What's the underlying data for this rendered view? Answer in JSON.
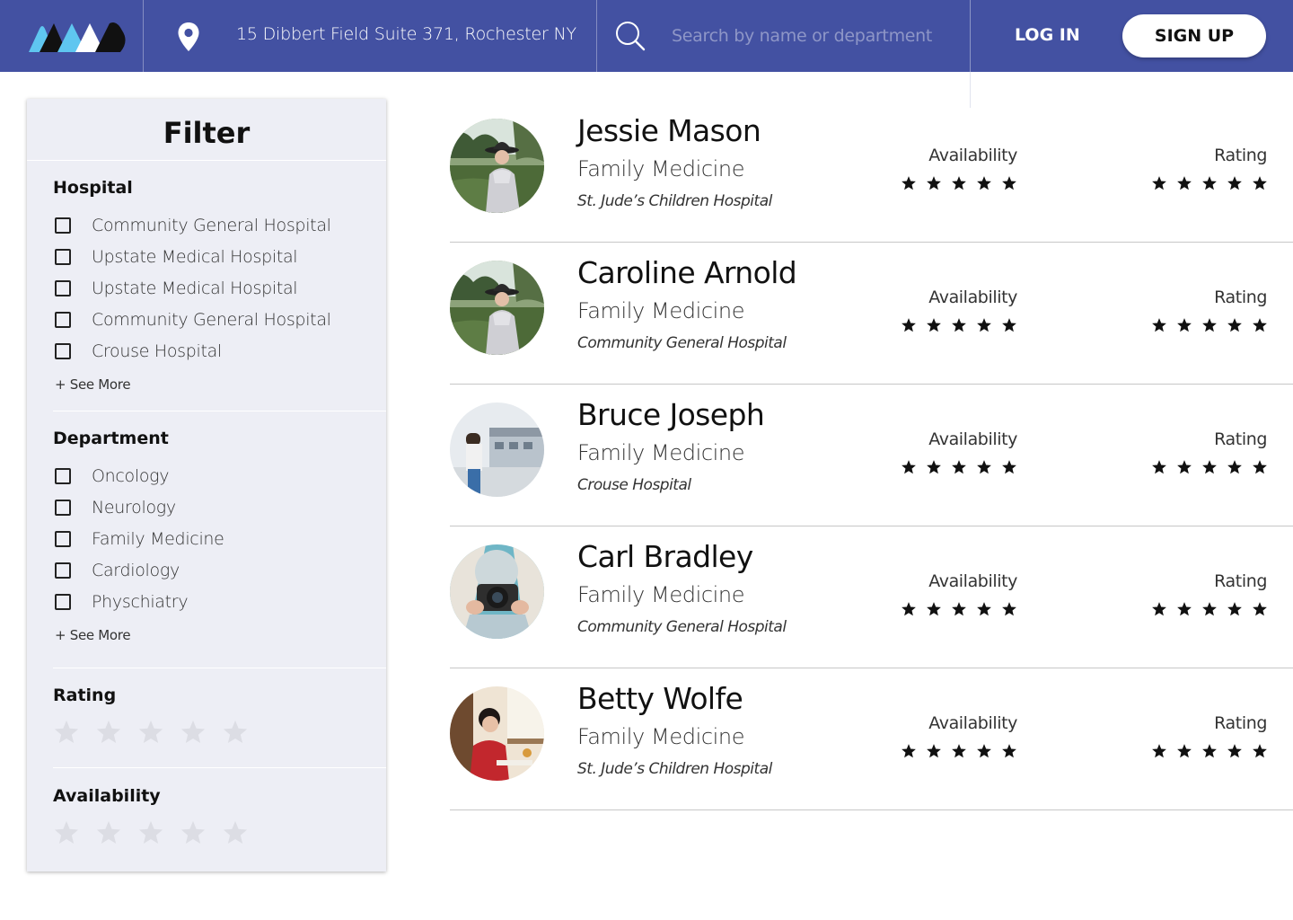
{
  "header": {
    "address": "15 Dibbert Field Suite 371, Rochester NY",
    "search_placeholder": "Search by name or department",
    "login_label": "LOG IN",
    "signup_label": "SIGN UP",
    "colors": {
      "bar": "#4351a2",
      "logo_accent": "#5fc6f0"
    }
  },
  "filter": {
    "title": "Filter",
    "hospital": {
      "title": "Hospital",
      "options": [
        "Community General Hospital",
        "Upstate Medical Hospital",
        "Upstate Medical Hospital",
        "Community General Hospital",
        "Crouse Hospital"
      ],
      "see_more": "+ See More"
    },
    "department": {
      "title": "Department",
      "options": [
        "Oncology",
        "Neurology",
        "Family Medicine",
        "Cardiology",
        "Physchiatry"
      ],
      "see_more": "+ See More"
    },
    "rating": {
      "title": "Rating",
      "selected": 0,
      "max": 5
    },
    "availability": {
      "title": "Availability",
      "selected": 0,
      "max": 5
    }
  },
  "doctors": [
    {
      "name": "Jessie Mason",
      "specialty": "Family Medicine",
      "hospital": "St. Jude’s Children Hospital",
      "availability_label": "Availability",
      "rating_label": "Rating",
      "availability": 5,
      "rating": 5,
      "photo": "woman-in-field-icon"
    },
    {
      "name": "Caroline Arnold",
      "specialty": "Family Medicine",
      "hospital": "Community General Hospital",
      "availability_label": "Availability",
      "rating_label": "Rating",
      "availability": 5,
      "rating": 5,
      "photo": "woman-in-field-icon"
    },
    {
      "name": "Bruce Joseph",
      "specialty": "Family Medicine",
      "hospital": "Crouse Hospital",
      "availability_label": "Availability",
      "rating_label": "Rating",
      "availability": 5,
      "rating": 5,
      "photo": "person-by-building-icon"
    },
    {
      "name": "Carl Bradley",
      "specialty": "Family Medicine",
      "hospital": "Community General Hospital",
      "availability_label": "Availability",
      "rating_label": "Rating",
      "availability": 5,
      "rating": 5,
      "photo": "person-with-camera-icon"
    },
    {
      "name": "Betty Wolfe",
      "specialty": "Family Medicine",
      "hospital": "St. Jude’s Children Hospital",
      "availability_label": "Availability",
      "rating_label": "Rating",
      "availability": 5,
      "rating": 5,
      "photo": "woman-in-red-icon"
    }
  ]
}
